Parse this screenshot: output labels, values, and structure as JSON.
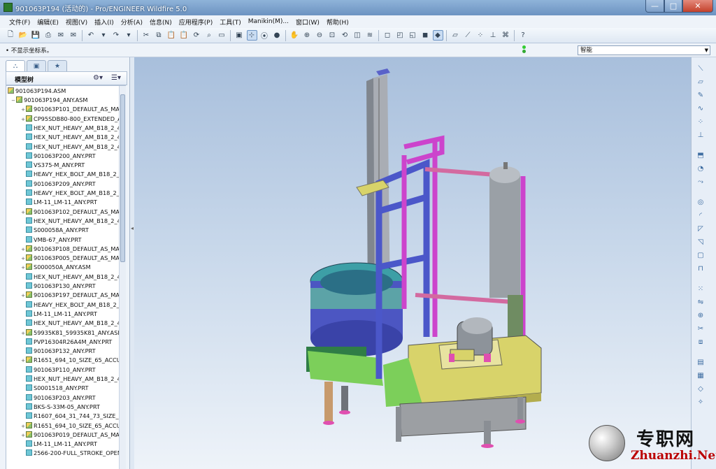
{
  "window": {
    "title": "901063P194 (活动的) - Pro/ENGINEER Wildfire 5.0",
    "controls": {
      "minimize": "—",
      "maximize": "□",
      "close": "✕"
    }
  },
  "menu": [
    "文件(F)",
    "编辑(E)",
    "视图(V)",
    "插入(I)",
    "分析(A)",
    "信息(N)",
    "应用程序(P)",
    "工具(T)",
    "Manikin(M)...",
    "窗口(W)",
    "帮助(H)"
  ],
  "toolbar": {
    "icons": [
      "new-file-icon",
      "open-file-icon",
      "save-icon",
      "print-icon",
      "email-icon",
      "email-link-icon",
      "sep",
      "undo-icon",
      "undo-dropdown-icon",
      "redo-icon",
      "redo-dropdown-icon",
      "sep",
      "cut-icon",
      "copy-icon",
      "paste-icon",
      "paste-special-icon",
      "regenerate-icon",
      "find-icon",
      "select-box-icon",
      "sep",
      "redraw-icon",
      "spin-center-icon",
      "orient-icon",
      "appearance-icon",
      "sep",
      "pan-icon",
      "zoom-in-icon",
      "zoom-out-icon",
      "refit-icon",
      "reorient-icon",
      "saved-views-icon",
      "layers-icon",
      "sep",
      "wireframe-icon",
      "hidden-line-icon",
      "no-hidden-icon",
      "shading-icon",
      "enhanced-realism-icon",
      "sep",
      "datum-planes-icon",
      "datum-axes-icon",
      "datum-points-icon",
      "coord-systems-icon",
      "annotations-icon",
      "sep",
      "context-help-icon"
    ],
    "active_indices": [
      21,
      37
    ]
  },
  "message_bar": {
    "message": "• 不显示坐标系。",
    "filter_value": "智能"
  },
  "model_tree": {
    "header_label": "模型树",
    "tabs": [
      "model-tree-tab",
      "folder-browser-tab",
      "favorites-tab"
    ],
    "root": "901063P194.ASM",
    "items": [
      {
        "label": "901063P194_ANY.ASM",
        "type": "asm",
        "level": 1,
        "expander": "−"
      },
      {
        "label": "901063P101_DEFAULT_AS_MA",
        "type": "asm",
        "level": 2,
        "expander": "+"
      },
      {
        "label": "CP95SDB80-800_EXTENDED_A",
        "type": "asm",
        "level": 2,
        "expander": "+"
      },
      {
        "label": "HEX_NUT_HEAVY_AM_B18_2_4",
        "type": "prt",
        "level": 2,
        "expander": ""
      },
      {
        "label": "HEX_NUT_HEAVY_AM_B18_2_4",
        "type": "prt",
        "level": 2,
        "expander": ""
      },
      {
        "label": "HEX_NUT_HEAVY_AM_B18_2_4",
        "type": "prt",
        "level": 2,
        "expander": ""
      },
      {
        "label": "901063P200_ANY.PRT",
        "type": "prt",
        "level": 2,
        "expander": ""
      },
      {
        "label": "VS375-M_ANY.PRT",
        "type": "prt",
        "level": 2,
        "expander": ""
      },
      {
        "label": "HEAVY_HEX_BOLT_AM_B18_2_",
        "type": "prt",
        "level": 2,
        "expander": ""
      },
      {
        "label": "901063P209_ANY.PRT",
        "type": "prt",
        "level": 2,
        "expander": ""
      },
      {
        "label": "HEAVY_HEX_BOLT_AM_B18_2_",
        "type": "prt",
        "level": 2,
        "expander": ""
      },
      {
        "label": "LM-11_LM-11_ANY.PRT",
        "type": "prt",
        "level": 2,
        "expander": ""
      },
      {
        "label": "901063P102_DEFAULT_AS_MA",
        "type": "asm",
        "level": 2,
        "expander": "+"
      },
      {
        "label": "HEX_NUT_HEAVY_AM_B18_2_4",
        "type": "prt",
        "level": 2,
        "expander": ""
      },
      {
        "label": "S000058A_ANY.PRT",
        "type": "prt",
        "level": 2,
        "expander": ""
      },
      {
        "label": "VMB-67_ANY.PRT",
        "type": "prt",
        "level": 2,
        "expander": ""
      },
      {
        "label": "901063P108_DEFAULT_AS_MA",
        "type": "asm",
        "level": 2,
        "expander": "+"
      },
      {
        "label": "901063P005_DEFAULT_AS_MA",
        "type": "asm",
        "level": 2,
        "expander": "+"
      },
      {
        "label": "S000050A_ANY.ASM",
        "type": "asm",
        "level": 2,
        "expander": "+"
      },
      {
        "label": "HEX_NUT_HEAVY_AM_B18_2_4",
        "type": "prt",
        "level": 2,
        "expander": ""
      },
      {
        "label": "901063P130_ANY.PRT",
        "type": "prt",
        "level": 2,
        "expander": ""
      },
      {
        "label": "901063P197_DEFAULT_AS_MA",
        "type": "asm",
        "level": 2,
        "expander": "+"
      },
      {
        "label": "HEAVY_HEX_BOLT_AM_B18_2_",
        "type": "prt",
        "level": 2,
        "expander": ""
      },
      {
        "label": "LM-11_LM-11_ANY.PRT",
        "type": "prt",
        "level": 2,
        "expander": ""
      },
      {
        "label": "HEX_NUT_HEAVY_AM_B18_2_4",
        "type": "prt",
        "level": 2,
        "expander": ""
      },
      {
        "label": "59935K81_59935K81_ANY.ASM",
        "type": "asm",
        "level": 2,
        "expander": "+"
      },
      {
        "label": "PVP16304R26A4M_ANY.PRT",
        "type": "prt",
        "level": 2,
        "expander": ""
      },
      {
        "label": "901063P132_ANY.PRT",
        "type": "prt",
        "level": 2,
        "expander": ""
      },
      {
        "label": "R1651_694_10_SIZE_65_ACCUR",
        "type": "asm",
        "level": 2,
        "expander": "+"
      },
      {
        "label": "901063P110_ANY.PRT",
        "type": "prt",
        "level": 2,
        "expander": ""
      },
      {
        "label": "HEX_NUT_HEAVY_AM_B18_2_4",
        "type": "prt",
        "level": 2,
        "expander": ""
      },
      {
        "label": "S0001518_ANY.PRT",
        "type": "prt",
        "level": 2,
        "expander": ""
      },
      {
        "label": "901063P203_ANY.PRT",
        "type": "prt",
        "level": 2,
        "expander": ""
      },
      {
        "label": "BKS-S-33M-05_ANY.PRT",
        "type": "prt",
        "level": 2,
        "expander": ""
      },
      {
        "label": "R1607_604_31_744_73_SIZE_S",
        "type": "prt",
        "level": 2,
        "expander": ""
      },
      {
        "label": "R1651_694_10_SIZE_65_ACCUR",
        "type": "asm",
        "level": 2,
        "expander": "+"
      },
      {
        "label": "901063P019_DEFAULT_AS_MA",
        "type": "asm",
        "level": 2,
        "expander": "+"
      },
      {
        "label": "LM-11_LM-11_ANY.PRT",
        "type": "prt",
        "level": 2,
        "expander": ""
      },
      {
        "label": "2566-200-FULL_STROKE_OPEN",
        "type": "prt",
        "level": 2,
        "expander": ""
      }
    ]
  },
  "right_toolbar": {
    "icons": [
      "datum-axis-icon",
      "plane-icon",
      "sketch-icon",
      "curve-icon",
      "point-icon",
      "csys-icon",
      "sep",
      "extrude-icon",
      "revolve-icon",
      "sweep-icon",
      "sep",
      "hole-icon",
      "round-icon",
      "chamfer-icon",
      "draft-icon",
      "shell-icon",
      "rib-icon",
      "sep",
      "pattern-icon",
      "mirror-icon",
      "merge-icon",
      "trim-icon",
      "offset-icon",
      "sep",
      "thicken-icon",
      "solidify-icon",
      "boundary-icon",
      "style-icon"
    ]
  },
  "watermark": {
    "name": "专职网",
    "url": "Zhuanzhi.Net"
  },
  "colors": {
    "accent_blue": "#4b57c9",
    "frame_magenta": "#cc44cc",
    "frame_yellow": "#d8d36a",
    "frame_green": "#7ccf5a",
    "cylinder_gray": "#9aa0a6"
  }
}
